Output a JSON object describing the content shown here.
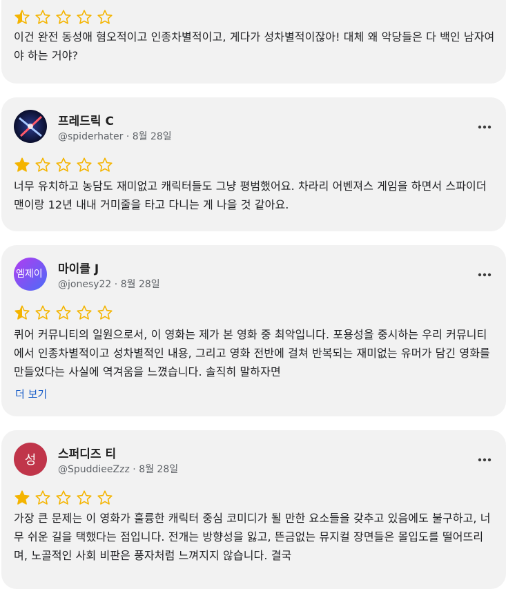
{
  "colors": {
    "star": "#f4b400",
    "card": "#f2f2f2",
    "link": "#1a5ec8"
  },
  "reviews": [
    {
      "rating": 0.5,
      "text": "이건 완전 동성애 혐오적이고 인종차별적이고, 게다가 성차별적이잖아! 대체 왜 악당들은 다 백인 남자여야 하는 거야?"
    },
    {
      "name": "프레드릭 C",
      "handle": "@spiderhater",
      "date": "8월 28일",
      "rating": 1,
      "text": "너무 유치하고 농담도 재미없고 캐릭터들도 그냥 평범했어요. 차라리 어벤져스 게임을 하면서 스파이더맨이랑 12년 내내 거미줄을 타고 다니는 게 나을 것 같아요."
    },
    {
      "name": "마이클 J",
      "handle": "@jonesy22",
      "date": "8월 28일",
      "avatar_text": "엠제이",
      "rating": 0.5,
      "text": "퀴어 커뮤니티의 일원으로서, 이 영화는 제가 본 영화 중 최악입니다. 포용성을 중시하는 우리 커뮤니티에서 인종차별적이고 성차별적인 내용, 그리고 영화 전반에 걸쳐 반복되는 재미없는 유머가 담긴 영화를 만들었다는 사실에 역겨움을 느꼈습니다. 솔직히 말하자면",
      "more_label": "더 보기"
    },
    {
      "name": "스퍼디즈 티",
      "handle": "@SpuddieeZzz",
      "date": "8월 28일",
      "avatar_text": "성",
      "rating": 1,
      "text": "가장 큰 문제는 이 영화가 훌륭한 캐릭터 중심 코미디가 될 만한 요소들을 갖추고 있음에도 불구하고, 너무 쉬운 길을 택했다는 점입니다. 전개는 방향성을 잃고, 뜬금없는 뮤지컬 장면들은 몰입도를 떨어뜨리며, 노골적인 사회 비판은 풍자처럼 느껴지지 않습니다. 결국"
    }
  ]
}
